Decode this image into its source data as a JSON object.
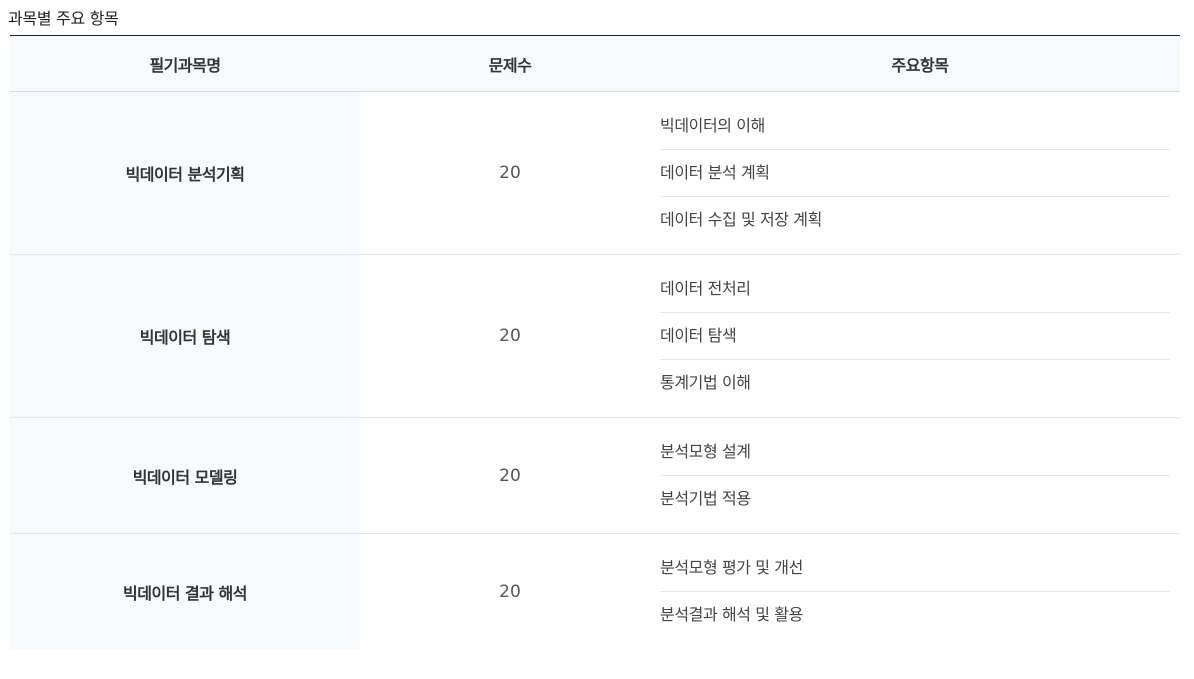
{
  "section_title": "과목별 주요 항목",
  "table": {
    "headers": {
      "subject": "필기과목명",
      "count": "문제수",
      "items": "주요항목"
    },
    "rows": [
      {
        "subject": "빅데이터 분석기획",
        "count": "20",
        "items": [
          "빅데이터의 이해",
          "데이터 분석 계획",
          "데이터 수집 및 저장 계획"
        ]
      },
      {
        "subject": "빅데이터 탐색",
        "count": "20",
        "items": [
          "데이터 전처리",
          "데이터 탐색",
          "통계기법 이해"
        ]
      },
      {
        "subject": "빅데이터 모델링",
        "count": "20",
        "items": [
          "분석모형 설계",
          "분석기법 적용"
        ]
      },
      {
        "subject": "빅데이터 결과 해석",
        "count": "20",
        "items": [
          "분석모형 평가 및 개선",
          "분석결과 해석 및 활용"
        ]
      }
    ]
  }
}
